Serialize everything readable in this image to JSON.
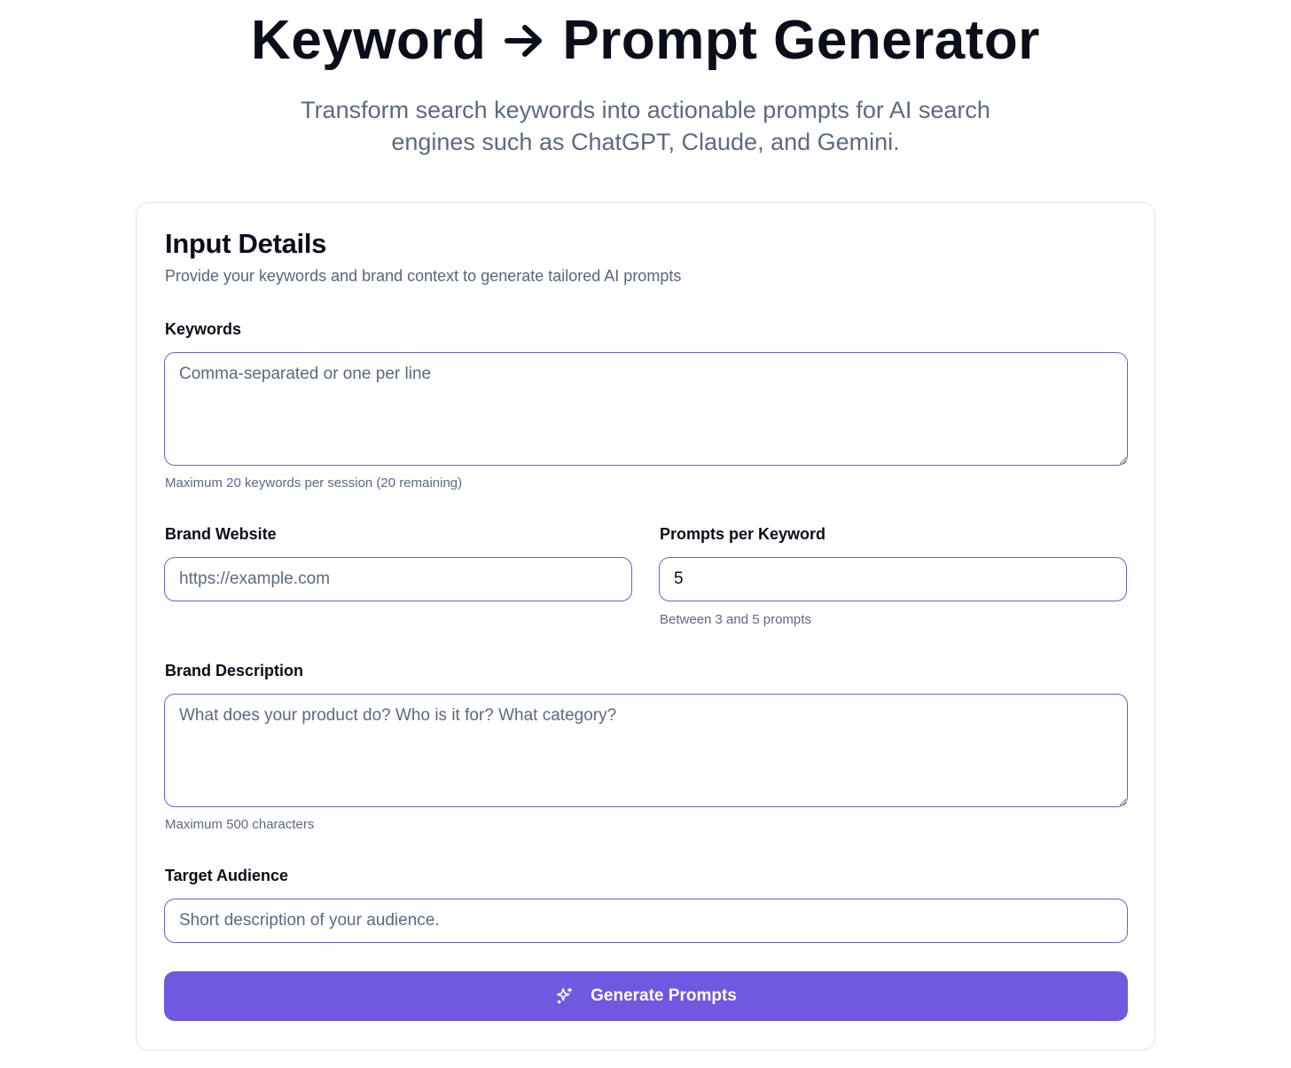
{
  "header": {
    "title_left": "Keyword",
    "title_right": "Prompt Generator",
    "arrow_icon": "arrow-right-icon",
    "subtitle": "Transform search keywords into actionable prompts for AI search engines such as ChatGPT, Claude, and Gemini."
  },
  "form": {
    "title": "Input Details",
    "description": "Provide your keywords and brand context to generate tailored AI prompts",
    "keywords": {
      "label": "Keywords",
      "placeholder": "Comma-separated or one per line",
      "value": "",
      "hint": "Maximum 20 keywords per session (20 remaining)"
    },
    "brand_website": {
      "label": "Brand Website",
      "placeholder": "https://example.com",
      "value": ""
    },
    "prompts_per_keyword": {
      "label": "Prompts per Keyword",
      "value": "5",
      "hint": "Between 3 and 5 prompts"
    },
    "brand_description": {
      "label": "Brand Description",
      "placeholder": "What does your product do? Who is it for? What category?",
      "value": "",
      "hint": "Maximum 500 characters"
    },
    "target_audience": {
      "label": "Target Audience",
      "placeholder": "Short description of your audience.",
      "value": ""
    },
    "submit": {
      "label": "Generate Prompts",
      "icon": "sparkles-icon"
    }
  },
  "colors": {
    "accent": "#7058e0",
    "field_border": "#6f5de0",
    "muted_text": "#5b6a82",
    "heading": "#0a0e1a"
  }
}
